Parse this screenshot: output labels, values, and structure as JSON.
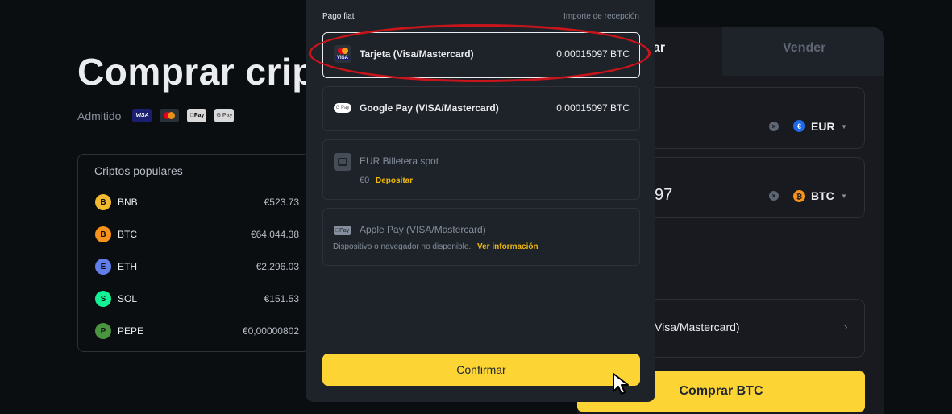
{
  "background": {
    "title": "Comprar cript",
    "supported_label": "Admitido",
    "payment_logos": [
      "VISA",
      "mastercard",
      "Pay",
      "G Pay"
    ],
    "popular": {
      "title": "Criptos populares",
      "coins": [
        {
          "symbol": "BNB",
          "price": "€523.73",
          "color": "#f3ba2f"
        },
        {
          "symbol": "BTC",
          "price": "€64,044.38",
          "color": "#f7931a"
        },
        {
          "symbol": "ETH",
          "price": "€2,296.03",
          "color": "#627eea"
        },
        {
          "symbol": "SOL",
          "price": "€151.53",
          "color": "#14f195"
        },
        {
          "symbol": "PEPE",
          "price": "€0,00000802",
          "color": "#4c9540"
        }
      ]
    },
    "trade": {
      "tab_buy": "ar",
      "tab_sell": "Vender",
      "spend_currency": "EUR",
      "receive_value": "97",
      "receive_currency": "BTC",
      "payment_method": "Visa/Mastercard)",
      "buy_button": "Comprar BTC"
    }
  },
  "modal": {
    "header_left": "Pago fiat",
    "header_right": "Importe de recepción",
    "options": {
      "card": {
        "name": "Tarjeta (Visa/Mastercard)",
        "amount": "0.00015097 BTC"
      },
      "gpay": {
        "name": "Google Pay (VISA/Mastercard)",
        "amount": "0.00015097 BTC"
      },
      "spot": {
        "name": "EUR Billetera spot",
        "balance": "€0",
        "action": "Depositar"
      },
      "apple": {
        "name": "Apple Pay (VISA/Mastercard)",
        "note": "Dispositivo o navegador no disponible.",
        "action": "Ver información"
      }
    },
    "confirm": "Confirmar"
  },
  "colors": {
    "accent": "#fcd535",
    "annotation": "#c8141b"
  }
}
